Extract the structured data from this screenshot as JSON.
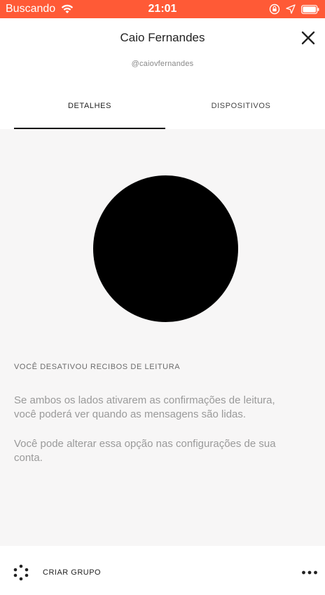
{
  "status_bar": {
    "carrier": "Buscando",
    "time": "21:01",
    "color": "#ff5a36"
  },
  "header": {
    "name": "Caio Fernandes",
    "handle": "@caiovfernandes"
  },
  "tabs": [
    {
      "label": "DETALHES",
      "active": true
    },
    {
      "label": "DISPOSITIVOS",
      "active": false
    }
  ],
  "details": {
    "receipt_title": "VOCÊ DESATIVOU RECIBOS DE LEITURA",
    "receipt_text_1": "Se ambos os lados ativarem as confirmações de leitura, você poderá ver quando as mensagens são lidas.",
    "receipt_text_2": "Você pode alterar essa opção nas configurações de sua conta."
  },
  "bottom_bar": {
    "create_group_label": "CRIAR GRUPO"
  },
  "icons": {
    "wifi": "wifi-icon",
    "screen_lock": "rotation-lock-icon",
    "location": "location-arrow-icon",
    "battery": "battery-icon",
    "close": "close-icon",
    "create_group": "group-dots-icon",
    "more": "more-horizontal-icon"
  }
}
